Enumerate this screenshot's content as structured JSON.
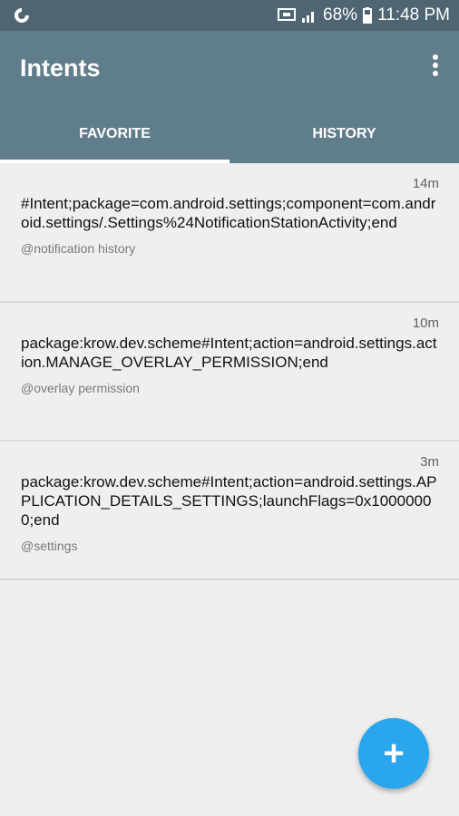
{
  "status_bar": {
    "battery": "68%",
    "time": "11:48 PM"
  },
  "app_bar": {
    "title": "Intents"
  },
  "tabs": [
    {
      "label": "FAVORITE"
    },
    {
      "label": "HISTORY"
    }
  ],
  "intents": [
    {
      "time": "14m",
      "text": "#Intent;package=com.android.settings;component=com.android.settings/.Settings%24NotificationStationActivity;end",
      "tag": "@notification history"
    },
    {
      "time": "10m",
      "text": "package:krow.dev.scheme#Intent;action=android.settings.action.MANAGE_OVERLAY_PERMISSION;end",
      "tag": "@overlay permission"
    },
    {
      "time": "3m",
      "text": "package:krow.dev.scheme#Intent;action=android.settings.APPLICATION_DETAILS_SETTINGS;launchFlags=0x10000000;end",
      "tag": "@settings"
    }
  ],
  "fab": {
    "icon": "plus-icon",
    "label": "+"
  },
  "colors": {
    "primary": "#607d8b",
    "primary_dark": "#4f6572",
    "accent": "#2aa6ee"
  }
}
